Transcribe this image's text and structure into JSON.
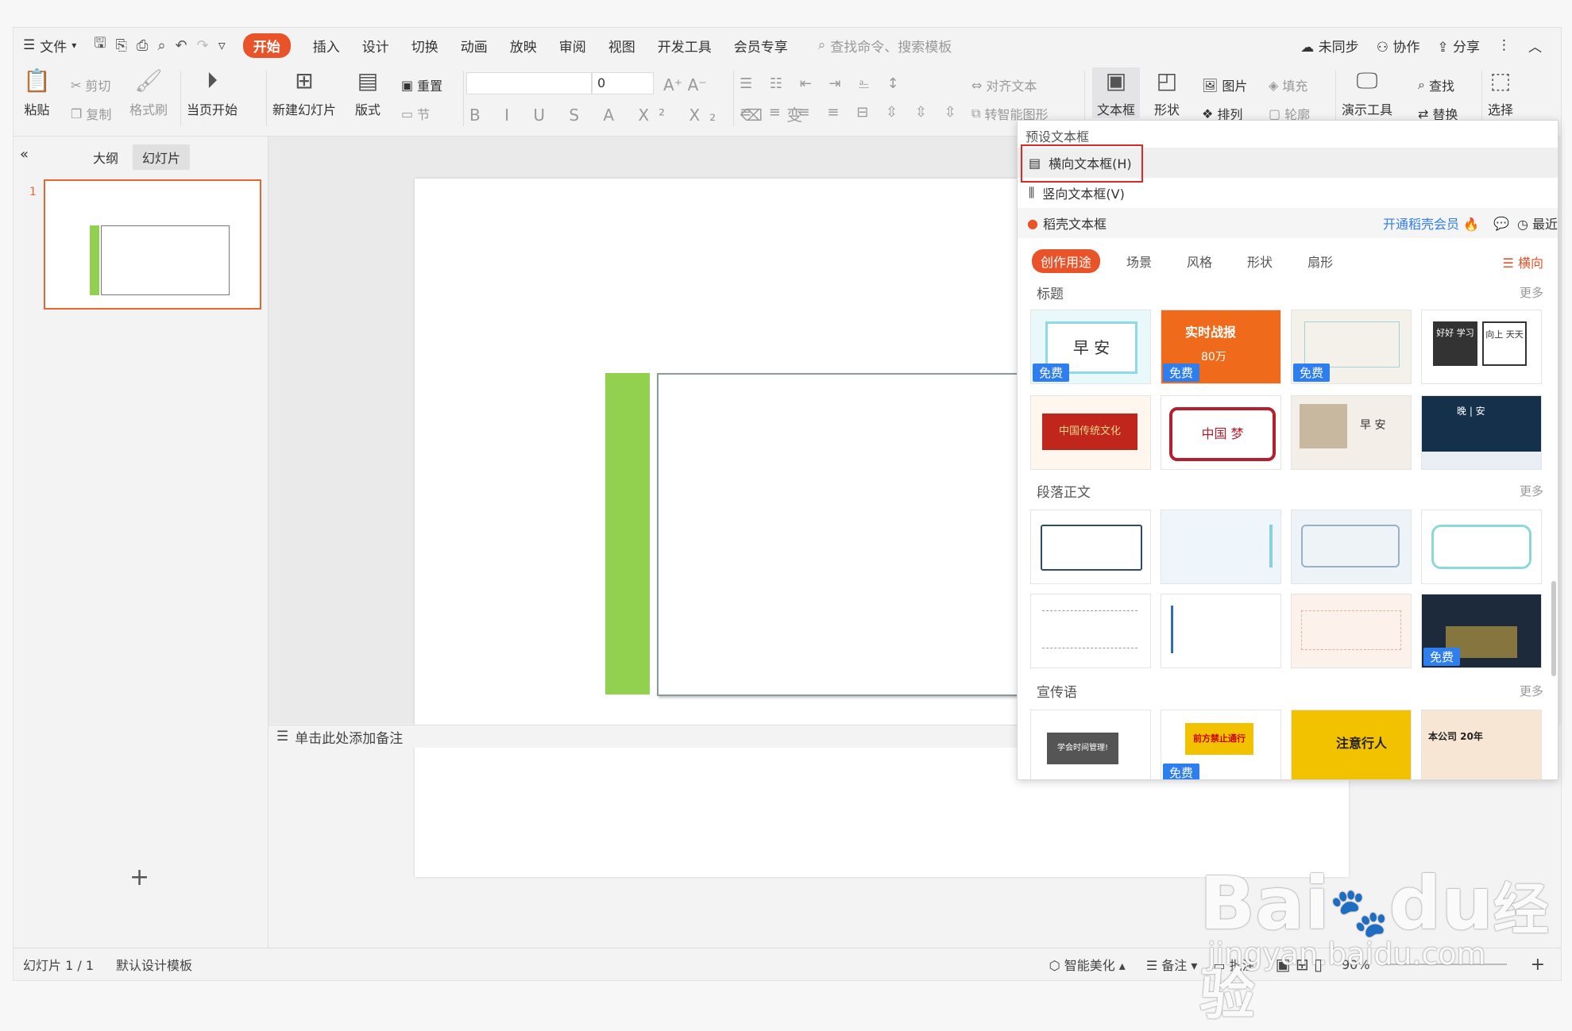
{
  "menu": {
    "file": "文件",
    "tabs": [
      "开始",
      "插入",
      "设计",
      "切换",
      "动画",
      "放映",
      "审阅",
      "视图",
      "开发工具",
      "会员专享"
    ],
    "search_placeholder": "查找命令、搜索模板",
    "right": [
      "未同步",
      "协作",
      "分享"
    ]
  },
  "ribbon": {
    "paste": "粘贴",
    "cut": "剪切",
    "copy": "复制",
    "format_painter": "格式刷",
    "play_from_current": "当页开始",
    "new_slide": "新建幻灯片",
    "layout": "版式",
    "reset": "重置",
    "section": "节",
    "font_size": "0",
    "align_text": "对齐文本",
    "convert_smartart": "转智能图形",
    "textbox": "文本框",
    "shape": "形状",
    "picture": "图片",
    "arrange": "排列",
    "fill": "填充",
    "outline": "轮廓",
    "present_tools": "演示工具",
    "find": "查找",
    "replace": "替换",
    "select": "选择"
  },
  "leftpane": {
    "outline_tab": "大纲",
    "slides_tab": "幻灯片",
    "slide_number": "1"
  },
  "notes_placeholder": "单击此处添加备注",
  "status": {
    "slide_info": "幻灯片 1 / 1",
    "template": "默认设计模板",
    "beautify": "智能美化",
    "notes": "备注",
    "comment": "批注",
    "zoom": "90%"
  },
  "panel": {
    "preset_title": "预设文本框",
    "horizontal": "横向文本框(H)",
    "vertical": "竖向文本框(V)",
    "docer_title": "稻壳文本框",
    "vip": "开通稻壳会员",
    "recent": "最近",
    "filters": [
      "创作用途",
      "场景",
      "风格",
      "形状",
      "扇形"
    ],
    "orientation": "横向",
    "sections": {
      "title": "标题",
      "paragraph": "段落正文",
      "slogan": "宣传语"
    },
    "more": "更多",
    "free": "免费",
    "card_texts": {
      "c1": "早 安",
      "c2": "实时战报",
      "c2b": "80万",
      "c4a": "好好 学习",
      "c4b": "向上 天天",
      "c5": "中国传统文化",
      "c6": "中国 梦",
      "c7": "早 安",
      "c8": "晚 | 安",
      "s1": "学会时间管理!",
      "s2": "前方禁止通行",
      "s3": "注意行人",
      "s4": "本公司 20年"
    }
  },
  "watermark": {
    "brand": "Bai",
    "brand2": "du",
    "cn": "经验",
    "url": "jingyan.baidu.com"
  },
  "colors": {
    "accent": "#e8532a",
    "green_bar": "#92d050",
    "highlight_box": "#e02828",
    "free_badge": "#2f7ef0"
  }
}
